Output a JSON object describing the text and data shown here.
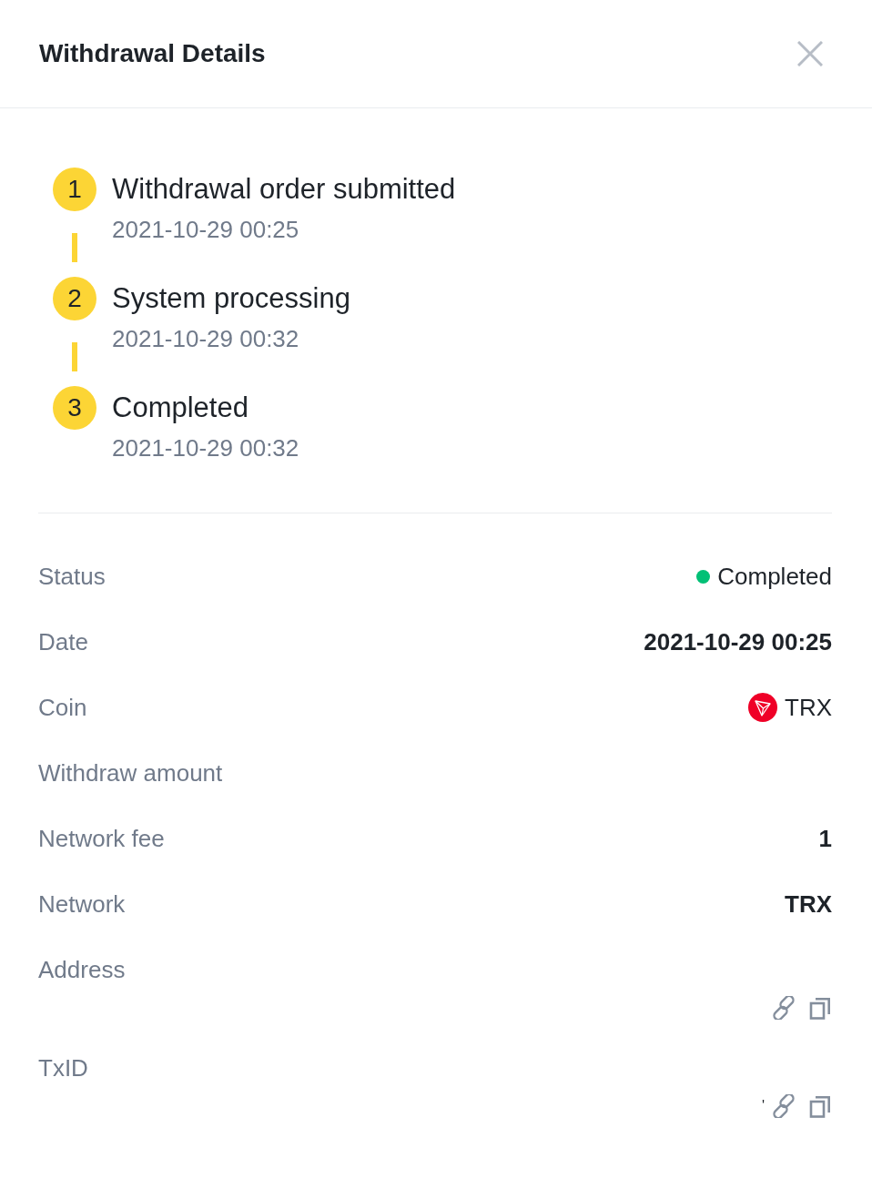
{
  "header": {
    "title": "Withdrawal Details"
  },
  "steps": [
    {
      "number": "1",
      "title": "Withdrawal order submitted",
      "time": "2021-10-29 00:25",
      "done": true
    },
    {
      "number": "2",
      "title": "System processing",
      "time": "2021-10-29 00:32",
      "done": true
    },
    {
      "number": "3",
      "title": "Completed",
      "time": "2021-10-29 00:32",
      "done": true
    }
  ],
  "details": [
    {
      "kind": "status",
      "label": "Status",
      "value": "Completed",
      "color": "#02c076"
    },
    {
      "kind": "text",
      "label": "Date",
      "value": "2021-10-29 00:25"
    },
    {
      "kind": "coin",
      "label": "Coin",
      "value": "TRX"
    },
    {
      "kind": "text",
      "label": "Withdraw amount"
    },
    {
      "kind": "text",
      "label": "Network fee",
      "value": "1"
    },
    {
      "kind": "text",
      "label": "Network",
      "value": "TRX"
    },
    {
      "kind": "link",
      "label": "Address"
    },
    {
      "kind": "link",
      "label": "TxID",
      "value": "'"
    }
  ]
}
